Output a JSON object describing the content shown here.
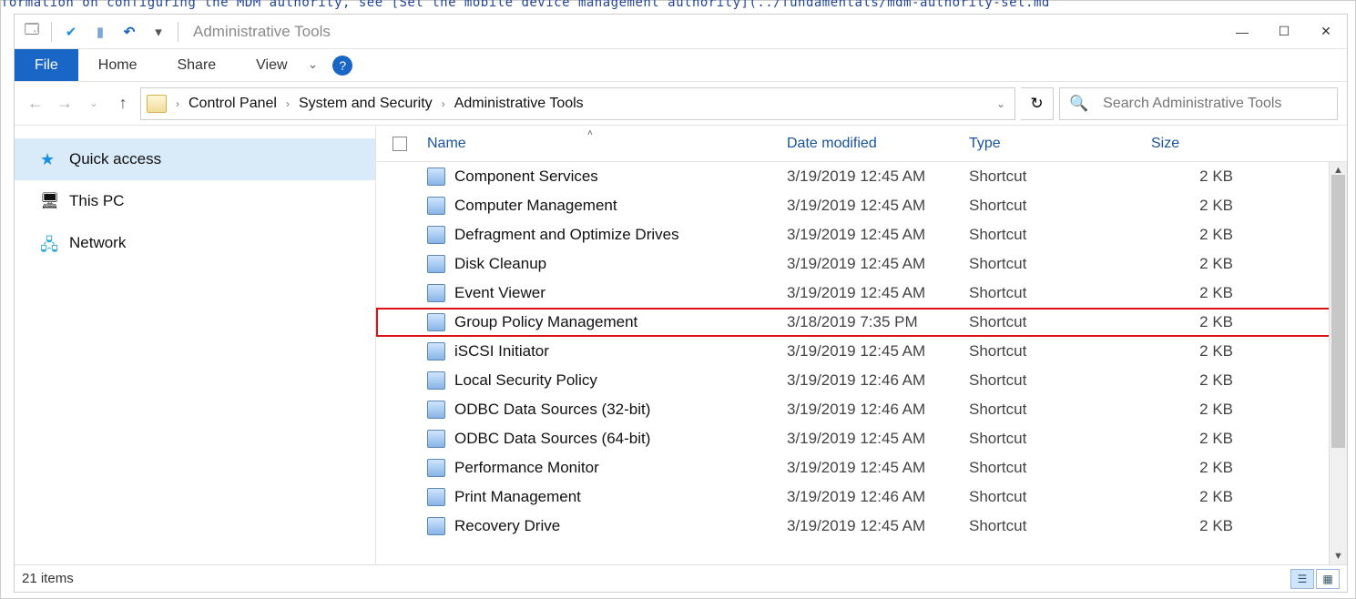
{
  "window": {
    "title": "Administrative Tools"
  },
  "ribbon": {
    "tabs": {
      "file": "File",
      "home": "Home",
      "share": "Share",
      "view": "View"
    }
  },
  "breadcrumb": {
    "0": "Control Panel",
    "1": "System and Security",
    "2": "Administrative Tools"
  },
  "search": {
    "placeholder": "Search Administrative Tools"
  },
  "nav": {
    "quick_access": "Quick access",
    "this_pc": "This PC",
    "network": "Network"
  },
  "columns": {
    "name": "Name",
    "date": "Date modified",
    "type": "Type",
    "size": "Size"
  },
  "files": [
    {
      "name": "Component Services",
      "date": "3/19/2019 12:45 AM",
      "type": "Shortcut",
      "size": "2 KB",
      "hl": false
    },
    {
      "name": "Computer Management",
      "date": "3/19/2019 12:45 AM",
      "type": "Shortcut",
      "size": "2 KB",
      "hl": false
    },
    {
      "name": "Defragment and Optimize Drives",
      "date": "3/19/2019 12:45 AM",
      "type": "Shortcut",
      "size": "2 KB",
      "hl": false
    },
    {
      "name": "Disk Cleanup",
      "date": "3/19/2019 12:45 AM",
      "type": "Shortcut",
      "size": "2 KB",
      "hl": false
    },
    {
      "name": "Event Viewer",
      "date": "3/19/2019 12:45 AM",
      "type": "Shortcut",
      "size": "2 KB",
      "hl": false
    },
    {
      "name": "Group Policy Management",
      "date": "3/18/2019 7:35 PM",
      "type": "Shortcut",
      "size": "2 KB",
      "hl": true
    },
    {
      "name": "iSCSI Initiator",
      "date": "3/19/2019 12:45 AM",
      "type": "Shortcut",
      "size": "2 KB",
      "hl": false
    },
    {
      "name": "Local Security Policy",
      "date": "3/19/2019 12:46 AM",
      "type": "Shortcut",
      "size": "2 KB",
      "hl": false
    },
    {
      "name": "ODBC Data Sources (32-bit)",
      "date": "3/19/2019 12:46 AM",
      "type": "Shortcut",
      "size": "2 KB",
      "hl": false
    },
    {
      "name": "ODBC Data Sources (64-bit)",
      "date": "3/19/2019 12:45 AM",
      "type": "Shortcut",
      "size": "2 KB",
      "hl": false
    },
    {
      "name": "Performance Monitor",
      "date": "3/19/2019 12:45 AM",
      "type": "Shortcut",
      "size": "2 KB",
      "hl": false
    },
    {
      "name": "Print Management",
      "date": "3/19/2019 12:46 AM",
      "type": "Shortcut",
      "size": "2 KB",
      "hl": false
    },
    {
      "name": "Recovery Drive",
      "date": "3/19/2019 12:45 AM",
      "type": "Shortcut",
      "size": "2 KB",
      "hl": false
    }
  ],
  "status": {
    "count": "21 items"
  }
}
